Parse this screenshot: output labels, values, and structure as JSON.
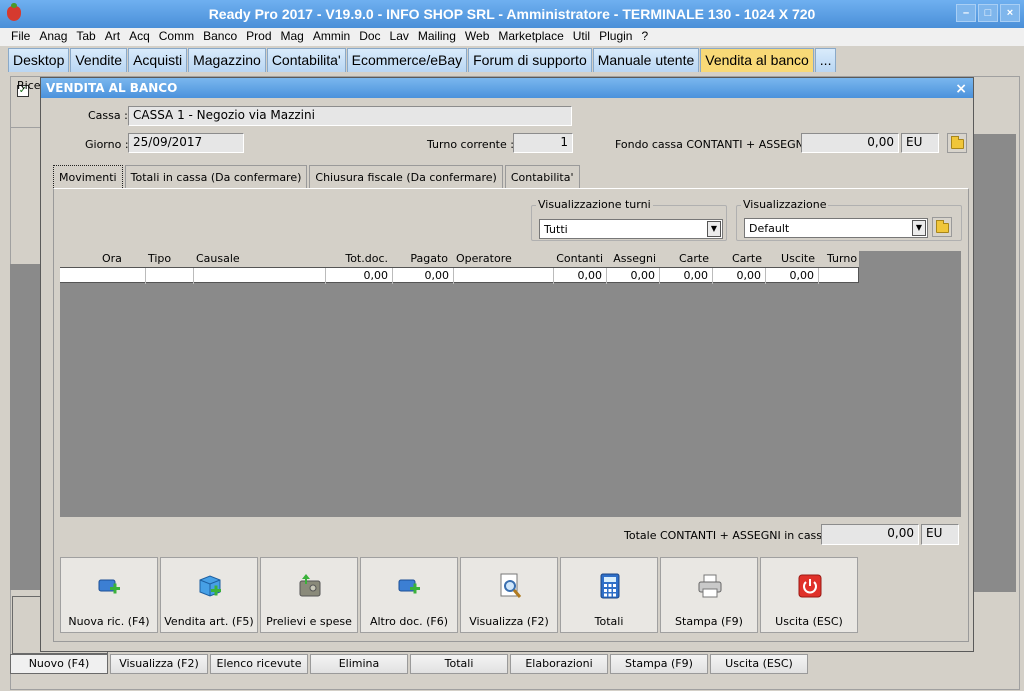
{
  "window": {
    "title": "Ready Pro 2017 - V19.9.0 - INFO SHOP SRL - Amministratore - TERMINALE 130 - 1024 X 720",
    "controls": [
      "–",
      "□",
      "×"
    ]
  },
  "menu": [
    "File",
    "Anag",
    "Tab",
    "Art",
    "Acq",
    "Comm",
    "Banco",
    "Prod",
    "Mag",
    "Ammin",
    "Doc",
    "Lav",
    "Mailing",
    "Web",
    "Marketplace",
    "Util",
    "Plugin",
    "?"
  ],
  "main_tabs": [
    "Desktop",
    "Vendite",
    "Acquisti",
    "Magazzino",
    "Contabilita'",
    "Ecommerce/eBay",
    "Forum di supporto",
    "Manuale utente",
    "Vendita al banco",
    "..."
  ],
  "background": {
    "recent_label": "Ricer",
    "checkbox_mark": "✓",
    "bottom_buttons": [
      "Nuovo (F4)",
      "Visualizza (F2)",
      "Elenco ricevute",
      "Elimina",
      "Totali",
      "Elaborazioni",
      "Stampa (F9)",
      "Uscita (ESC)"
    ]
  },
  "dialog": {
    "title": "VENDITA AL BANCO",
    "close": "×",
    "cassa_label": "Cassa :",
    "cassa_value": "CASSA 1 - Negozio via Mazzini",
    "giorno_label": "Giorno :",
    "giorno_value": "25/09/2017",
    "turno_label": "Turno corrente :",
    "turno_value": "1",
    "fondo_label": "Fondo cassa CONTANTI + ASSEGNI :",
    "fondo_value": "0,00",
    "fondo_currency": "EU",
    "tabs": [
      "Movimenti",
      "Totali in cassa (Da confermare)",
      "Chiusura fiscale (Da confermare)",
      "Contabilita'"
    ],
    "vis_turni_label": "Visualizzazione turni",
    "vis_turni_value": "Tutti",
    "vis_label": "Visualizzazione",
    "vis_value": "Default",
    "grid": {
      "columns": [
        "Ora",
        "Tipo",
        "Causale",
        "Tot.doc.",
        "Pagato",
        "Operatore",
        "Contanti",
        "Assegni",
        "Carte",
        "Carte",
        "Uscite",
        "Turno"
      ],
      "row": [
        "",
        "",
        "",
        "0,00",
        "0,00",
        "",
        "0,00",
        "0,00",
        "0,00",
        "0,00",
        "0,00",
        ""
      ]
    },
    "totale_label": "Totale CONTANTI + ASSEGNI in cassa :",
    "totale_value": "0,00",
    "totale_currency": "EU",
    "actions": [
      "Nuova ric. (F4)",
      "Vendita art. (F5)",
      "Prelievi e spese",
      "Altro doc. (F6)",
      "Visualizza (F2)",
      "Totali",
      "Stampa (F9)",
      "Uscita (ESC)"
    ]
  }
}
